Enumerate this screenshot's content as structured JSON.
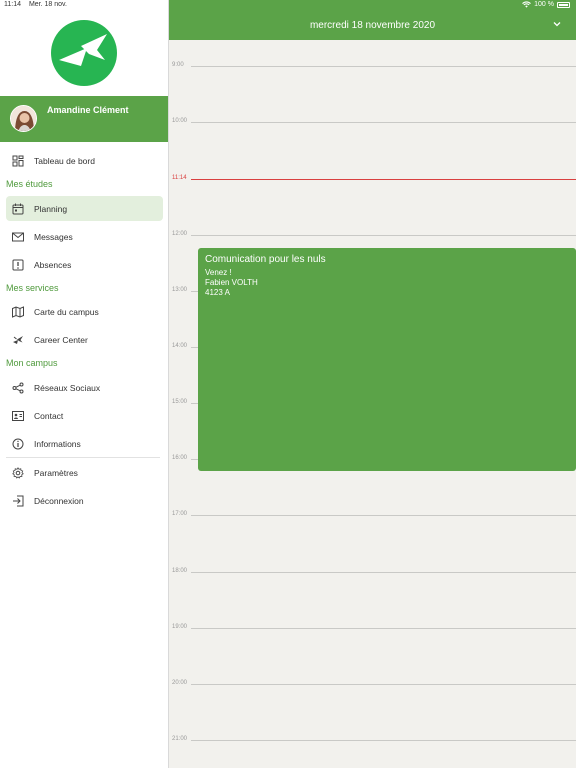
{
  "status_bar": {
    "time": "11:14",
    "date": "Mer. 18 nov.",
    "battery": "100 %"
  },
  "sidebar": {
    "user_name": "Amandine Clément",
    "dashboard_label": "Tableau de bord",
    "sections": {
      "etudes": "Mes études",
      "services": "Mes services",
      "campus": "Mon campus"
    },
    "items": {
      "planning": "Planning",
      "messages": "Messages",
      "absences": "Absences",
      "carte": "Carte du campus",
      "career": "Career Center",
      "reseaux": "Réseaux Sociaux",
      "contact": "Contact",
      "informations": "Informations",
      "parametres": "Paramètres",
      "deconnexion": "Déconnexion"
    }
  },
  "calendar": {
    "header_date": "mercredi 18 novembre 2020",
    "hours": [
      "9:00",
      "10:00",
      "12:00",
      "13:00",
      "14:00",
      "15:00",
      "16:00",
      "17:00",
      "18:00",
      "19:00",
      "20:00",
      "21:00"
    ],
    "now_label": "11:14",
    "event": {
      "title": "Comunication pour les nuls",
      "line1": "Venez !",
      "line2": "Fabien VOLTH",
      "line3": "4123 A"
    }
  },
  "colors": {
    "brand_green": "#5ba348",
    "now_red": "#d94040",
    "logo_green": "#27b552"
  }
}
